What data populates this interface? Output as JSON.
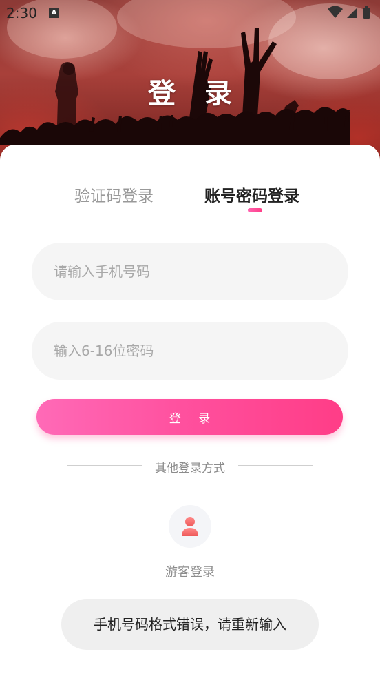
{
  "status_bar": {
    "time": "2:30",
    "notification_badge": "A",
    "icons": [
      "wifi-icon",
      "signal-icon",
      "battery-icon"
    ]
  },
  "header": {
    "title": "登 录"
  },
  "tabs": [
    {
      "label": "验证码登录",
      "active": false
    },
    {
      "label": "账号密码登录",
      "active": true
    }
  ],
  "form": {
    "phone_placeholder": "请输入手机号码",
    "phone_value": "",
    "password_placeholder": "输入6-16位密码",
    "password_value": "",
    "submit_label": "登 录"
  },
  "other_login": {
    "divider_label": "其他登录方式",
    "guest_icon": "person-icon",
    "guest_label": "游客登录"
  },
  "toast": {
    "message": "手机号码格式错误，请重新输入"
  },
  "colors": {
    "accent_start": "#ff6ab7",
    "accent_end": "#ff3d87",
    "input_bg": "#f5f5f5",
    "guest_icon": "#f26b6b"
  }
}
